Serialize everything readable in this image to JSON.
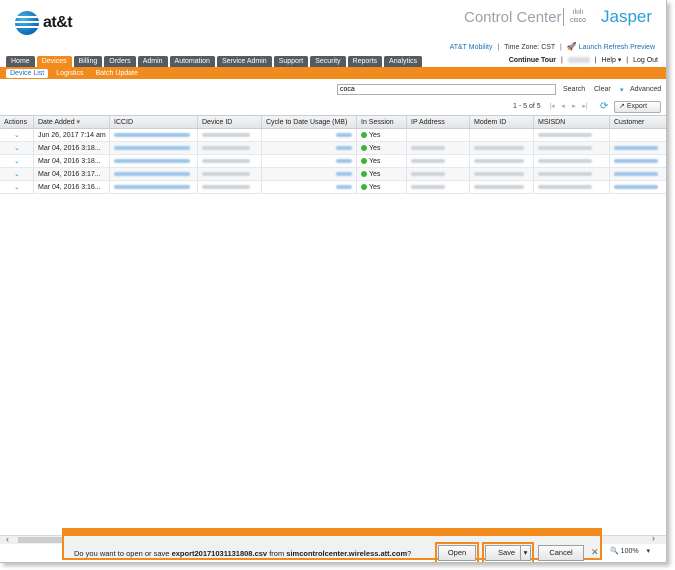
{
  "brand": {
    "logo_text": "at&t",
    "product": "Control Center",
    "cisco_line1": "ılıılı",
    "cisco_line2": "cisco",
    "jasper": "Jasper"
  },
  "subheader": {
    "mobility": "AT&T Mobility",
    "timezone": "Time Zone: CST",
    "refresh_preview": "Launch Refresh Preview"
  },
  "util": {
    "continue_tour": "Continue Tour",
    "help": "Help",
    "help_caret": "▾",
    "logout": "Log Out"
  },
  "nav_tabs": [
    "Home",
    "Devices",
    "Billing",
    "Orders",
    "Admin",
    "Automation",
    "Service Admin",
    "Support",
    "Security",
    "Reports",
    "Analytics"
  ],
  "sub_tabs": [
    "Device List",
    "Logistics",
    "Batch Update"
  ],
  "search": {
    "value": "coca",
    "search_label": "Search",
    "clear_label": "Clear",
    "advanced_label": "Advanced"
  },
  "pager": {
    "text": "1 - 5 of 5",
    "export_label": "Export"
  },
  "table": {
    "columns": [
      "Actions",
      "Date Added",
      "ICCID",
      "Device ID",
      "Cycle to Date Usage (MB)",
      "In Session",
      "IP Address",
      "Modem ID",
      "MSISDN",
      "Customer"
    ],
    "rows": [
      {
        "date": "Jun 26, 2017 7:14 am",
        "session": "Yes"
      },
      {
        "date": "Mar 04, 2016 3:18...",
        "session": "Yes"
      },
      {
        "date": "Mar 04, 2016 3:18...",
        "session": "Yes"
      },
      {
        "date": "Mar 04, 2016 3:17...",
        "session": "Yes"
      },
      {
        "date": "Mar 04, 2016 3:16...",
        "session": "Yes"
      }
    ]
  },
  "download": {
    "msg_pre": "Do you want to open or save",
    "filename": "export20171031131808.csv",
    "msg_mid": "from",
    "site": "simcontrolcenter.wireless.att.com",
    "msg_end": "?",
    "open_label": "Open",
    "save_label": "Save",
    "cancel_label": "Cancel"
  },
  "zoom": "100%",
  "colors": {
    "accent": "#f28b1e",
    "tab": "#555b60",
    "link": "#1a6fb5",
    "session_dot": "#3cb43c"
  }
}
